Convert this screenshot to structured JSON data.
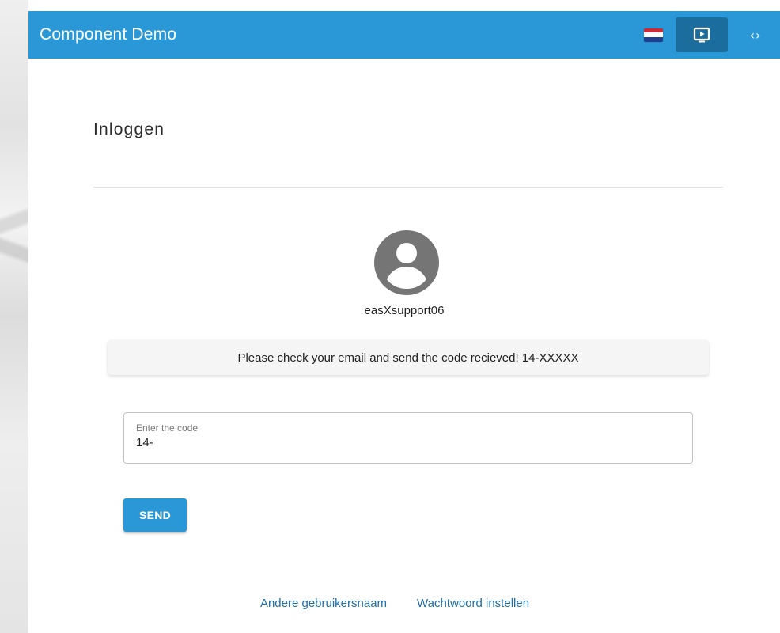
{
  "header": {
    "title": "Component Demo",
    "flag_icon": "netherlands-flag-icon",
    "preview_icon": "play-screen-icon",
    "code_toggle": "‹›",
    "accent": "#2a98d6"
  },
  "main": {
    "title": "Inloggen",
    "avatar_icon": "account-circle-icon",
    "username": "easXsupport06",
    "notice": "Please check your email and send the code recieved! 14-XXXXX",
    "code_field": {
      "label": "Enter the code",
      "value": "14-"
    },
    "send_label": "SEND"
  },
  "footer": {
    "links": [
      "Andere gebruikersnaam",
      "Wachtwoord instellen"
    ]
  }
}
